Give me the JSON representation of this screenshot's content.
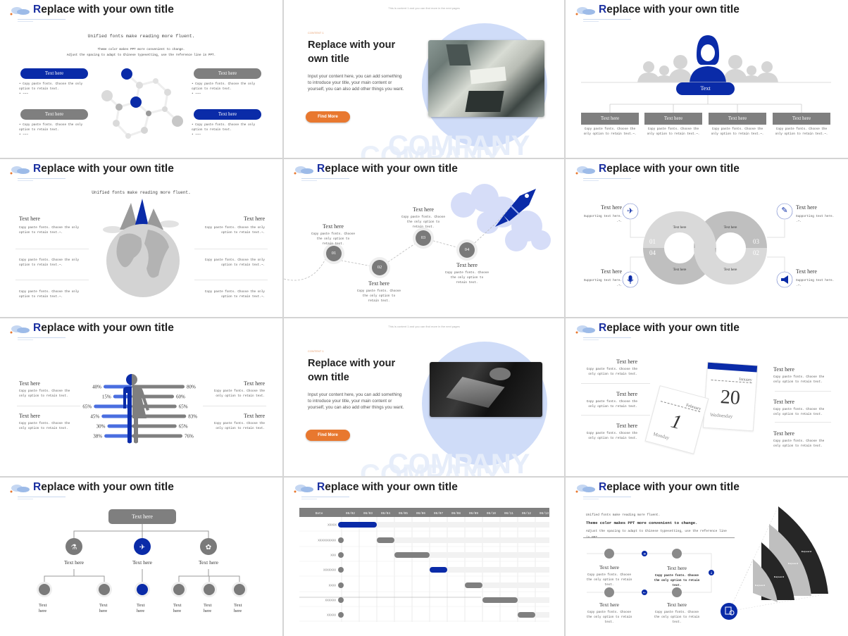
{
  "header_title": "Replace with your own title",
  "colors": {
    "brand_blue": "#0a2ba8",
    "gray": "#7f7f7f",
    "light_gray": "#d9d9d9",
    "orange": "#e8782f",
    "light_blue": "#cfdcf8"
  },
  "s1": {
    "subtitle": "Unified fonts make reading more fluent.",
    "line1": "Theme color makes PPT more convenient to change.",
    "line2": "Adjust the spacing to adapt to Chinese typesetting, use the reference line in PPT.",
    "pills": [
      "Text here",
      "Text here",
      "Text here",
      "Text here"
    ],
    "bullet": "Copy paste fonts. Choose the only option to retain text.",
    "bullet2": "~~~"
  },
  "content": {
    "top_note": "This is content 1 and you can find more in the next pages",
    "label": "CONTENT 1",
    "title": "Replace with your own title",
    "paragraph": "Input your content here, you can add something to introduce your title, your main content or yourself, you can also add other things you want.",
    "button": "Find More",
    "watermark": "COMPANY"
  },
  "s3": {
    "center_label": "Text",
    "boxes": [
      "Text here",
      "Text here",
      "Text here",
      "Text here"
    ],
    "desc": "Copy paste fonts. Choose the only option to retain text.~."
  },
  "s4": {
    "subtitle": "Unified fonts make reading more fluent.",
    "heading": "Text here",
    "desc": "Copy paste fonts. Choose the only option to retain text.~."
  },
  "s5": {
    "steps": [
      {
        "num": "01",
        "title": "Text here",
        "desc": "Copy paste fonts. Choose the only option to retain text."
      },
      {
        "num": "02",
        "title": "Text here",
        "desc": "Copy paste fonts. Choose the only option to retain text."
      },
      {
        "num": "03",
        "title": "Text here",
        "desc": "Copy paste fonts. Choose the only option to retain text."
      },
      {
        "num": "04",
        "title": "Text here",
        "desc": "Copy paste fonts. Choose the only option to retain text."
      }
    ]
  },
  "s6": {
    "segment_label": "Text here",
    "numbers": [
      "01",
      "02",
      "03",
      "04"
    ],
    "items": [
      {
        "title": "Text here",
        "desc": "Supporting text here. .~.",
        "icon": "airplane-icon"
      },
      {
        "title": "Text here",
        "desc": "Supporting text here. .~.",
        "icon": "pen-icon"
      },
      {
        "title": "Text here",
        "desc": "Supporting text here. .~.",
        "icon": "microphone-icon"
      },
      {
        "title": "Text here",
        "desc": "Supporting text here. .~.",
        "icon": "megaphone-icon"
      }
    ]
  },
  "s7": {
    "heading": "Text here",
    "desc": "Copy paste fonts. Choose the only option to retain text.",
    "left_values": [
      40,
      15,
      65,
      45,
      30,
      38
    ],
    "right_values": [
      80,
      60,
      65,
      83,
      65,
      76
    ]
  },
  "s9": {
    "heading": "Text here",
    "desc": "Copy paste fonts. Choose the only option to retain text.",
    "cal_back": {
      "month": "January",
      "day": "20",
      "weekday": "Wednesday"
    },
    "cal_front": {
      "month": "February",
      "day": "1",
      "weekday": "Monday"
    }
  },
  "s10": {
    "root": "Text here",
    "branch": "Text here",
    "leaf": "Text here"
  },
  "gantt": {
    "header": "Date",
    "dates": [
      "06/02",
      "06/03",
      "06/04",
      "06/05",
      "06/06",
      "06/07",
      "06/08",
      "06/09",
      "06/10",
      "06/11",
      "06/12",
      "06/13"
    ],
    "tasks": [
      {
        "label": "XXXXX",
        "start": "06/02",
        "end": "06/03",
        "highlight": true
      },
      {
        "label": "XXXXXXXXXX",
        "start": "06/04",
        "end": "06/04",
        "highlight": false
      },
      {
        "label": "XXX",
        "start": "06/05",
        "end": "06/06",
        "highlight": false
      },
      {
        "label": "XXXXXXX",
        "start": "06/07",
        "end": "06/07",
        "highlight": true
      },
      {
        "label": "XXXX",
        "start": "06/09",
        "end": "06/09",
        "highlight": false
      },
      {
        "label": "XXXXXX",
        "start": "06/10",
        "end": "06/11",
        "highlight": false
      },
      {
        "label": "XXXXX",
        "start": "06/12",
        "end": "06/12",
        "highlight": false
      }
    ]
  },
  "s12": {
    "line1": "Unified fonts make reading more fluent.",
    "line2": "Theme color makes PPT more convenient to change.",
    "line3": "Adjust the spacing to adapt to Chinese typesetting, use the reference line in PPT.",
    "heading": "Text here",
    "desc": "Copy paste fonts. Choose the only option to retain text.",
    "keyword": "Keyword"
  }
}
